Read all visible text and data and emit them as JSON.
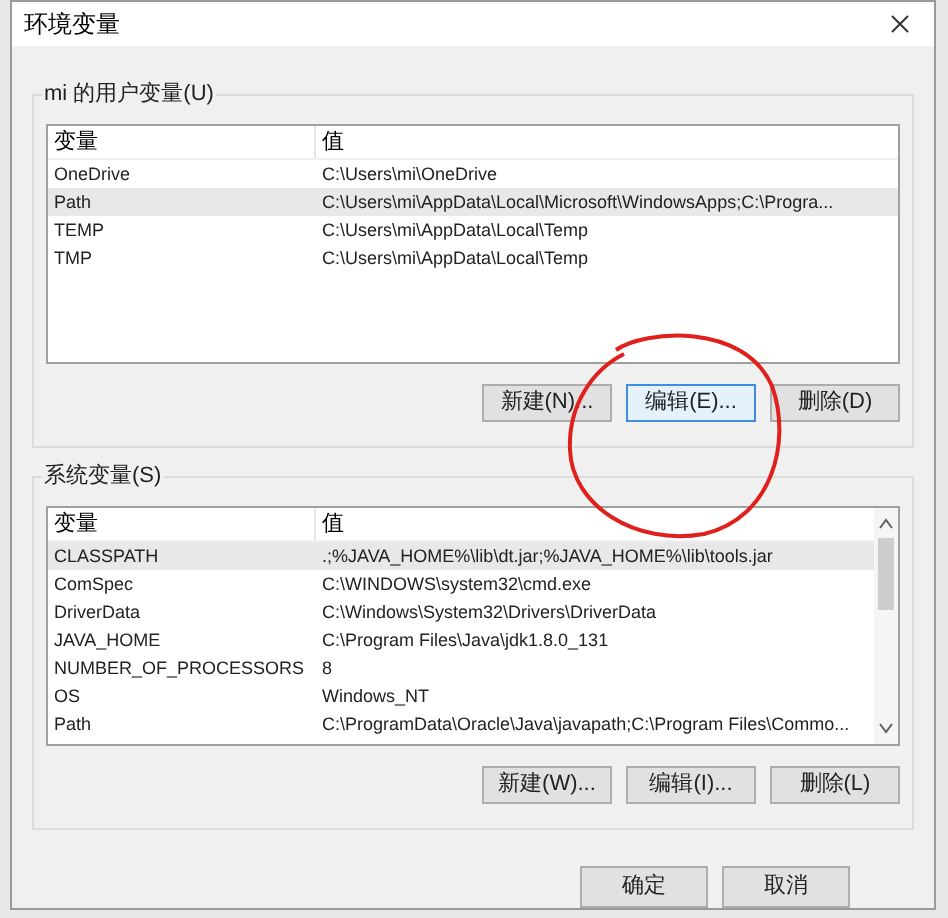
{
  "window": {
    "title": "环境变量"
  },
  "user_vars": {
    "label": "mi 的用户变量(U)",
    "columns": [
      "变量",
      "值"
    ],
    "rows": [
      {
        "name": "OneDrive",
        "value": "C:\\Users\\mi\\OneDrive",
        "selected": false
      },
      {
        "name": "Path",
        "value": "C:\\Users\\mi\\AppData\\Local\\Microsoft\\WindowsApps;C:\\Progra...",
        "selected": true
      },
      {
        "name": "TEMP",
        "value": "C:\\Users\\mi\\AppData\\Local\\Temp",
        "selected": false
      },
      {
        "name": "TMP",
        "value": "C:\\Users\\mi\\AppData\\Local\\Temp",
        "selected": false
      }
    ],
    "buttons": [
      {
        "label": "新建(N)...",
        "focused": false
      },
      {
        "label": "编辑(E)...",
        "focused": true
      },
      {
        "label": "删除(D)",
        "focused": false
      }
    ]
  },
  "system_vars": {
    "label": "系统变量(S)",
    "columns": [
      "变量",
      "值"
    ],
    "rows": [
      {
        "name": "CLASSPATH",
        "value": ".;%JAVA_HOME%\\lib\\dt.jar;%JAVA_HOME%\\lib\\tools.jar",
        "selected": true
      },
      {
        "name": "ComSpec",
        "value": "C:\\WINDOWS\\system32\\cmd.exe",
        "selected": false
      },
      {
        "name": "DriverData",
        "value": "C:\\Windows\\System32\\Drivers\\DriverData",
        "selected": false
      },
      {
        "name": "JAVA_HOME",
        "value": "C:\\Program Files\\Java\\jdk1.8.0_131",
        "selected": false
      },
      {
        "name": "NUMBER_OF_PROCESSORS",
        "value": "8",
        "selected": false
      },
      {
        "name": "OS",
        "value": "Windows_NT",
        "selected": false
      },
      {
        "name": "Path",
        "value": "C:\\ProgramData\\Oracle\\Java\\javapath;C:\\Program Files\\Commo...",
        "selected": false
      }
    ],
    "buttons": [
      {
        "label": "新建(W)...",
        "focused": false
      },
      {
        "label": "编辑(I)...",
        "focused": false
      },
      {
        "label": "删除(L)",
        "focused": false
      }
    ]
  },
  "footer_buttons": [
    {
      "label": "确定"
    },
    {
      "label": "取消"
    }
  ]
}
